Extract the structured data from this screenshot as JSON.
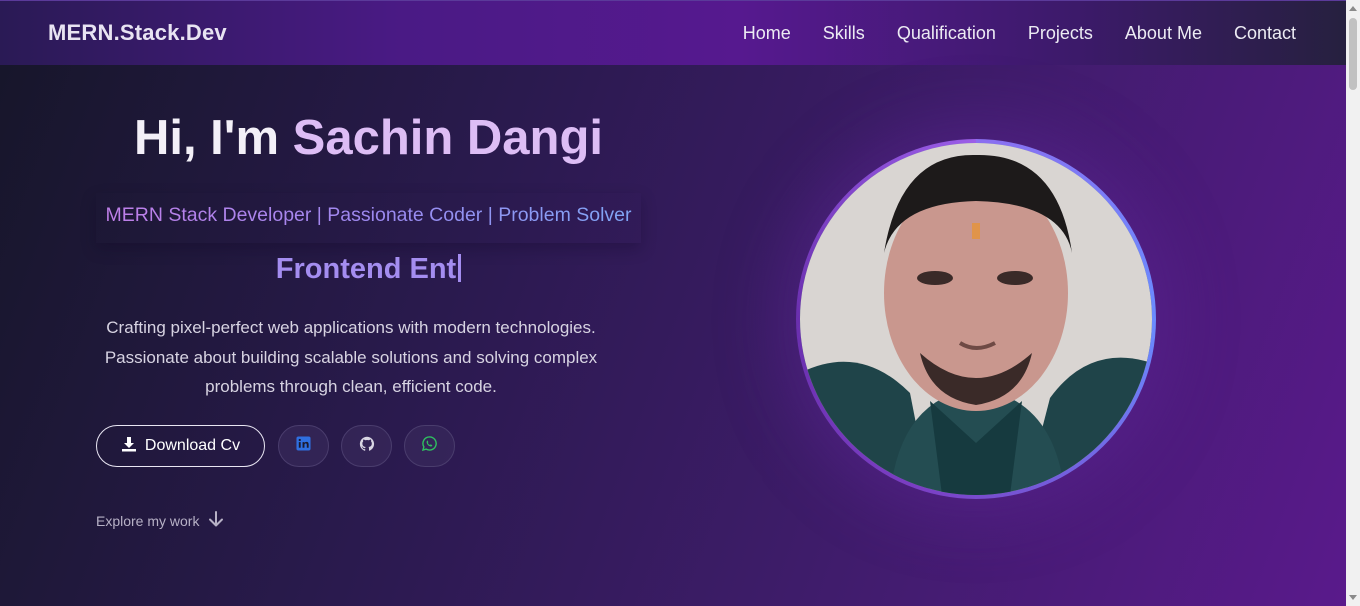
{
  "nav": {
    "brand": "MERN.Stack.Dev",
    "links": [
      "Home",
      "Skills",
      "Qualification",
      "Projects",
      "About Me",
      "Contact"
    ]
  },
  "hero": {
    "greeting": "Hi, I'm ",
    "name": "Sachin Dangi",
    "subtitle": "MERN Stack Developer | Passionate Coder | Problem Solver",
    "typing_text": "Frontend Ent",
    "description": "Crafting pixel-perfect web applications with modern technologies. Passionate about building scalable solutions and solving complex problems through clean, efficient code.",
    "download_label": "Download Cv",
    "explore_label": "Explore my work"
  },
  "social": [
    {
      "icon": "linkedin-icon",
      "color": "#2f6fe0"
    },
    {
      "icon": "github-icon",
      "color": "#d9d6e3"
    },
    {
      "icon": "whatsapp-icon",
      "color": "#2fbf60"
    }
  ],
  "colors": {
    "accent": "#a48df0",
    "name": "#ddbdf5"
  }
}
